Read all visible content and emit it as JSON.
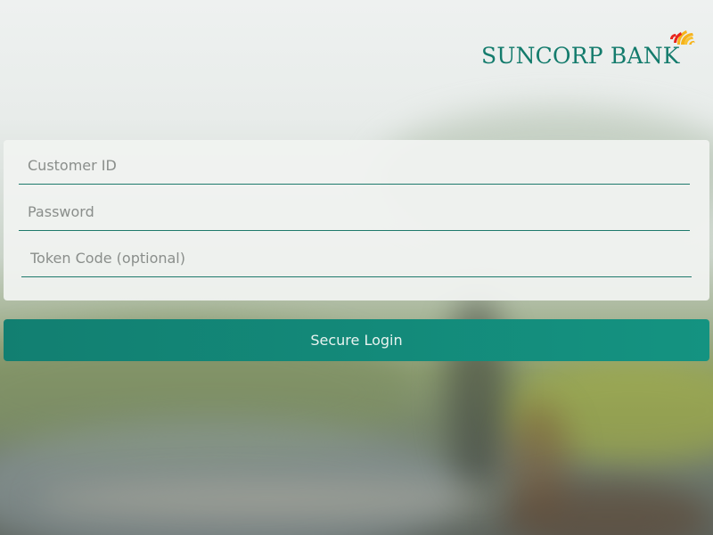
{
  "brand": {
    "name": "SUNCORP BANK",
    "color": "#137b6c",
    "sun_colors": [
      "#f6b31b",
      "#e8241c"
    ],
    "icon": "sun-logo-icon"
  },
  "login": {
    "customer_id_placeholder": "Customer ID",
    "password_placeholder": "Password",
    "token_placeholder": "Token Code (optional)",
    "customer_id_value": "",
    "password_value": "",
    "token_value": "",
    "submit_label": "Secure Login",
    "accent": "#138a78"
  }
}
